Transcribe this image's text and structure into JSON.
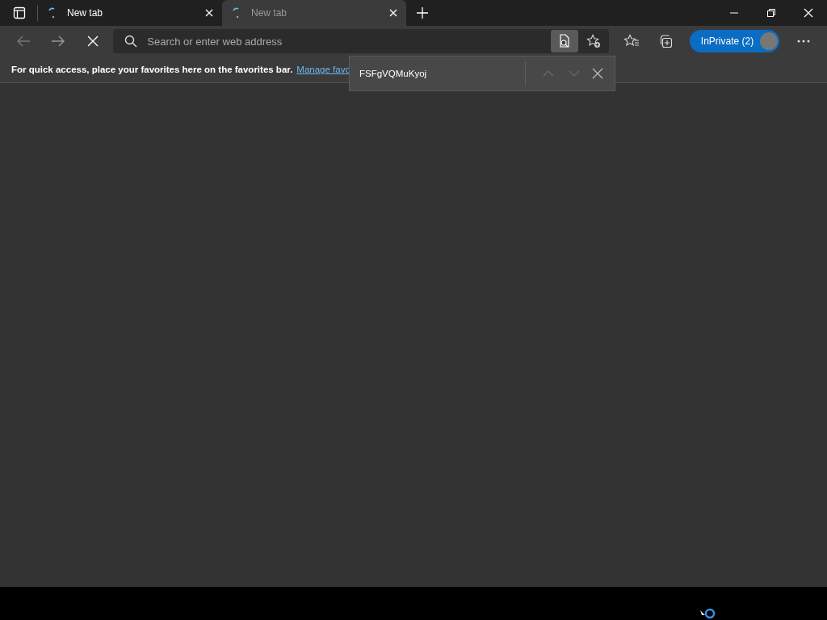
{
  "tabs": [
    {
      "title": "New tab",
      "loading": true,
      "selected": false
    },
    {
      "title": "New tab",
      "loading": true,
      "selected": true
    }
  ],
  "address_bar": {
    "placeholder": "Search or enter web address",
    "find_active": true
  },
  "profile": {
    "label": "InPrivate (2)"
  },
  "favorites_bar": {
    "message": "For quick access, place your favorites here on the favorites bar.",
    "link": "Manage favo"
  },
  "find_bar": {
    "value": "FSFgVQMuKyoj",
    "prev_disabled": true,
    "next_disabled": true
  }
}
